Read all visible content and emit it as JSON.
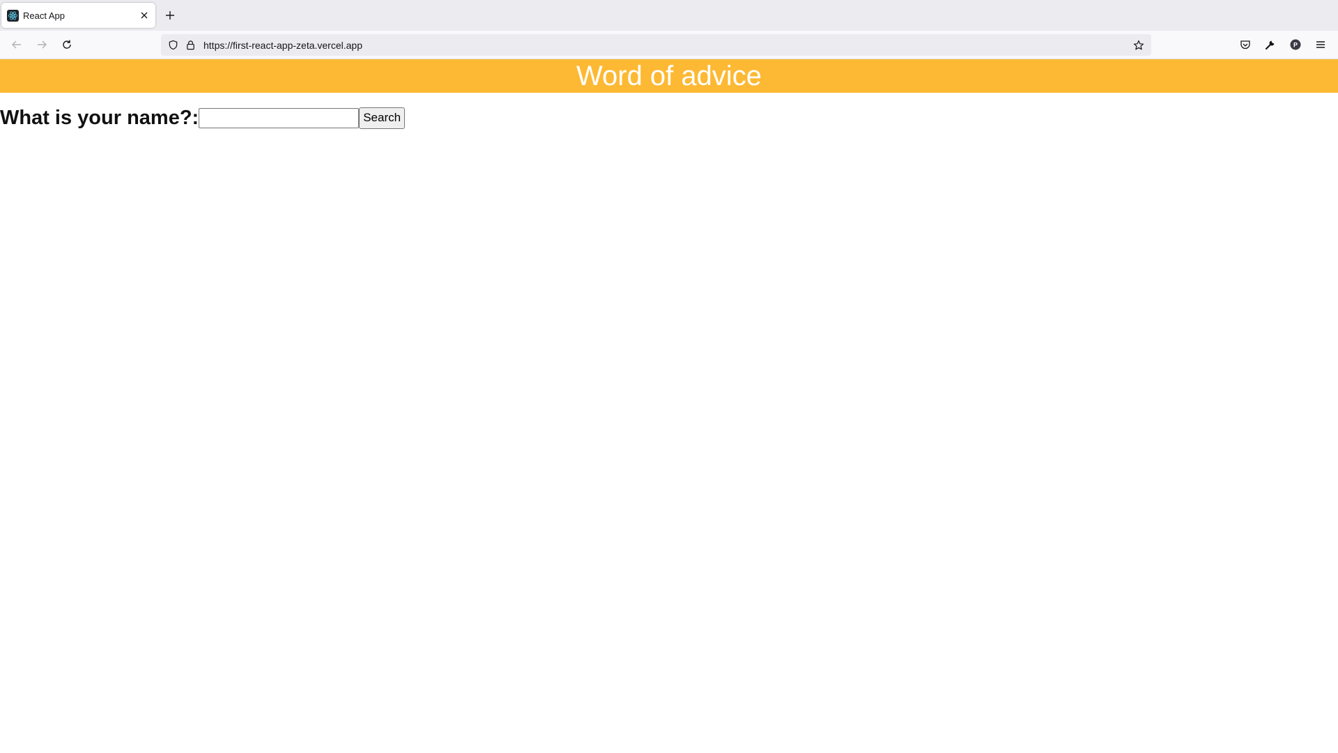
{
  "browser": {
    "tab": {
      "title": "React App",
      "favicon": "react-logo-icon"
    },
    "new_tab_icon": "plus-icon",
    "url": "https://first-react-app-zeta.vercel.app",
    "icons": [
      "back-icon",
      "forward-icon",
      "reload-icon",
      "shield-icon",
      "lock-icon",
      "star-icon",
      "pocket-icon",
      "wrench-icon",
      "profile-icon",
      "menu-icon"
    ],
    "profile_initial": "P"
  },
  "page": {
    "banner": {
      "title": "Word of advice",
      "background": "#fdb933",
      "text_color": "#ffffff"
    },
    "form": {
      "label": "What is your name?:",
      "input_value": "",
      "input_placeholder": "",
      "button_label": "Search"
    }
  }
}
